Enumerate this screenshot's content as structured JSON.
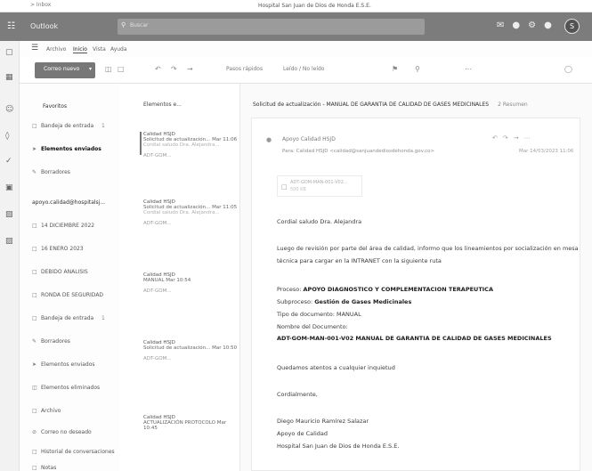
{
  "top_strip": {
    "left_text": "> Inbox",
    "center_text": "Hospital San Juan de Dios de Honda E.S.E."
  },
  "titlebar": {
    "app_name": "Outlook",
    "search_placeholder": "Buscar",
    "avatar_initial": "S"
  },
  "ribbon": {
    "tabs": [
      "Archivo",
      "Inicio",
      "Vista",
      "Ayuda"
    ],
    "active_tab": "Inicio"
  },
  "command_bar": {
    "new_mail_label": "Correo nuevo",
    "quick_steps": "Pasos rápidos",
    "read_unread": "Leído / No leído"
  },
  "folders": {
    "favorites_header": "Favoritos",
    "favorites": [
      {
        "label": "Bandeja de entrada",
        "count": "1"
      },
      {
        "label": "Elementos enviados",
        "count": ""
      },
      {
        "label": "Borradores",
        "count": ""
      }
    ],
    "account_header": "apoyo.calidad@hospitalsj...",
    "account_folders": [
      {
        "label": "14 DICIEMBRE 2022",
        "count": ""
      },
      {
        "label": "16 ENERO 2023",
        "count": ""
      },
      {
        "label": "DEBIDO ANALISIS",
        "count": ""
      },
      {
        "label": "RONDA DE SEGURIDAD",
        "count": ""
      },
      {
        "label": "Bandeja de entrada",
        "count": "1"
      },
      {
        "label": "Borradores",
        "count": ""
      },
      {
        "label": "Elementos enviados",
        "count": ""
      },
      {
        "label": "Elementos eliminados",
        "count": ""
      },
      {
        "label": "Archivo",
        "count": ""
      },
      {
        "label": "Correo no deseado",
        "count": ""
      },
      {
        "label": "Historial de conversaciones",
        "count": ""
      },
      {
        "label": "Notas",
        "count": ""
      }
    ]
  },
  "message_list": {
    "header": "Elementos e...",
    "items": [
      {
        "sender": "Calidad HSJD",
        "subject": "Solicitud de actualización...",
        "time": "Mar 11:06",
        "preview": "Cordial saludo Dra. Alejandra...",
        "attachment": "ADT-GOM..."
      },
      {
        "sender": "Calidad HSJD",
        "subject": "Solicitud de actualización...",
        "time": "Mar 11:05",
        "preview": "Cordial saludo Dra. Alejandra...",
        "attachment": "ADT-GOM..."
      },
      {
        "sender": "Calidad HSJD",
        "subject": "MANUAL",
        "time": "Mar 10:54",
        "preview": "",
        "attachment": "ADT-GOM..."
      },
      {
        "sender": "Calidad HSJD",
        "subject": "Solicitud de actualización...",
        "time": "Mar 10:50",
        "preview": "",
        "attachment": "ADT-GOM..."
      },
      {
        "sender": "Calidad HSJD",
        "subject": "ACTUALIZACIÓN PROTOCOLO",
        "time": "Mar 10:45",
        "preview": "",
        "attachment": ""
      }
    ]
  },
  "reading": {
    "subject": "Solicitud de actualización - MANUAL DE GARANTIA DE CALIDAD DE GASES MEDICINALES",
    "results": "2 Resumen",
    "from": "Apoyo Calidad HSJD",
    "to": "Para: Calidad HSJD <calidad@sanjuandediosdehonda.gov.co>",
    "date": "Mar 14/03/2023 11:06",
    "attachment_name": "ADT-GOM-MAN-001-V02...",
    "attachment_size": "500 KB",
    "greeting": "Cordial saludo Dra. Alejandra",
    "intro_line1": "Luego de revisión por parte del área de calidad, informo que los lineamientos por socialización en mesa",
    "intro_line2": "técnica para cargar en la INTRANET con la siguiente ruta",
    "proceso_label": "Proceso:",
    "proceso_value": "APOYO DIAGNOSTICO Y COMPLEMENTACION TERAPEUTICA",
    "subproceso_label": "Subproceso:",
    "subproceso_value": "Gestión de Gases Medicinales",
    "tipo_doc": "Tipo de documento: MANUAL",
    "nombre_doc_label": "Nombre del Documento:",
    "nombre_doc_value": "ADT-GOM-MAN-001-V02 MANUAL DE GARANTIA DE CALIDAD DE GASES MEDICINALES",
    "closing1": "Quedamos atentos a cualquier inquietud",
    "closing2": "Cordialmente,",
    "sig_name": "Diego Mauricio Ramírez Salazar",
    "sig_role": "Apoyo de Calidad",
    "sig_org": "Hospital San Juan de Dios de Honda E.S.E."
  }
}
